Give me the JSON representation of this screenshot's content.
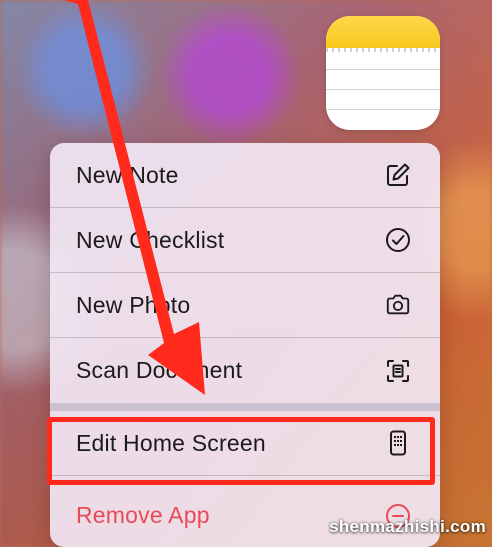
{
  "app": {
    "name": "Notes",
    "icon": "notes-app-icon",
    "accent": "#f7c81d"
  },
  "menu": {
    "items": [
      {
        "label": "New Note",
        "icon": "compose-icon"
      },
      {
        "label": "New Checklist",
        "icon": "checkmark-circle-icon"
      },
      {
        "label": "New Photo",
        "icon": "camera-icon"
      },
      {
        "label": "Scan Document",
        "icon": "document-scan-icon"
      },
      {
        "label": "Edit Home Screen",
        "icon": "phone-grid-icon"
      },
      {
        "label": "Remove App",
        "icon": "minus-circle-icon",
        "color": "#e84a57"
      }
    ]
  },
  "annotation": {
    "arrow_color": "#ff2a1c",
    "highlight_color": "#ff2a1c",
    "highlight_target": "Edit Home Screen"
  },
  "watermark": "shenmazhishi.com"
}
